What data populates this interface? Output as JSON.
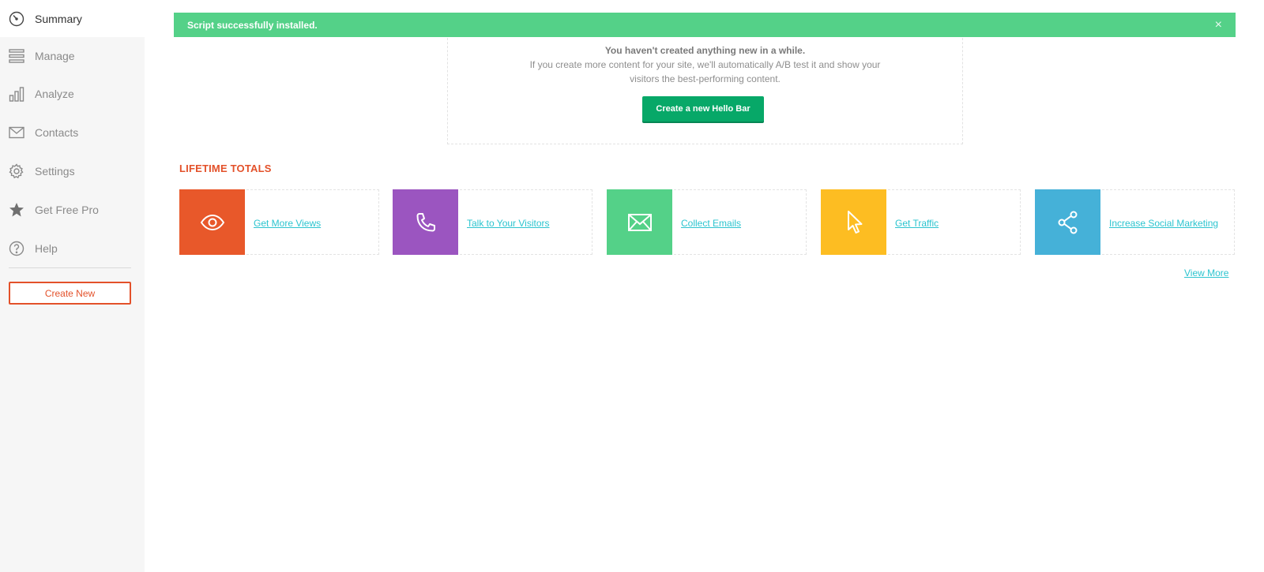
{
  "sidebar": {
    "items": [
      {
        "label": "Summary",
        "icon": "gauge-icon",
        "active": true
      },
      {
        "label": "Manage",
        "icon": "list-icon"
      },
      {
        "label": "Analyze",
        "icon": "bar-chart-icon"
      },
      {
        "label": "Contacts",
        "icon": "envelope-icon"
      },
      {
        "label": "Settings",
        "icon": "gear-icon"
      },
      {
        "label": "Get Free Pro",
        "icon": "star-icon"
      },
      {
        "label": "Help",
        "icon": "question-icon"
      }
    ],
    "create_new_label": "Create New"
  },
  "alert": {
    "message": "Script successfully installed.",
    "close_label": "×",
    "color": "#54d188"
  },
  "empty_state": {
    "title": "You haven't created anything new in a while.",
    "description": "If you create more content for your site, we'll automatically A/B test it and show your visitors the best-performing content.",
    "button_label": "Create a new Hello Bar"
  },
  "lifetime_totals": {
    "title": "LIFETIME TOTALS",
    "cards": [
      {
        "label": "Get More Views",
        "icon": "eye-icon",
        "color": "#e8582a"
      },
      {
        "label": "Talk to Your Visitors",
        "icon": "phone-icon",
        "color": "#9b55c0"
      },
      {
        "label": "Collect Emails",
        "icon": "envelope-icon",
        "color": "#54d188"
      },
      {
        "label": "Get Traffic",
        "icon": "cursor-icon",
        "color": "#fdbd22"
      },
      {
        "label": "Increase Social Marketing",
        "icon": "share-icon",
        "color": "#45b1d8"
      }
    ],
    "view_more_label": "View More"
  },
  "colors": {
    "accent": "#e3512a",
    "link": "#2cc4cf",
    "primary_button": "#07a868"
  }
}
